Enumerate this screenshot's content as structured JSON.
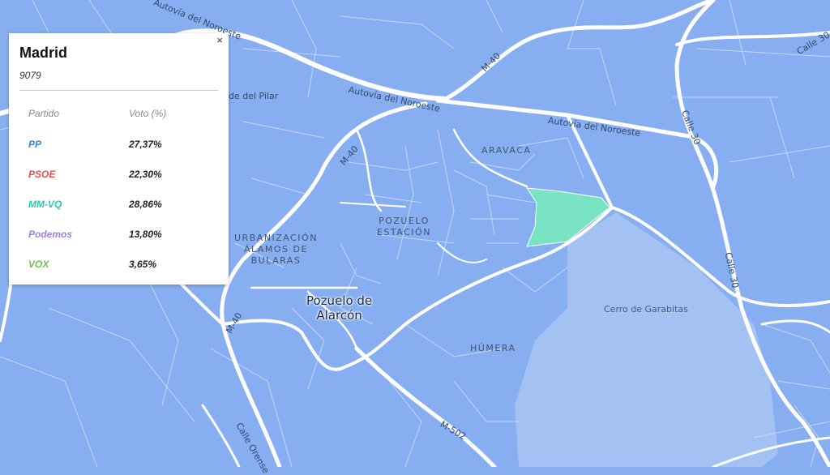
{
  "popup": {
    "title": "Madrid",
    "code": "9079",
    "close": "×",
    "col_party": "Partido",
    "col_vote": "Voto (%)",
    "rows": [
      {
        "party": "PP",
        "vote": "27,37%",
        "color": "#3b82d6"
      },
      {
        "party": "PSOE",
        "vote": "22,30%",
        "color": "#ef4b4b"
      },
      {
        "party": "MM-VQ",
        "vote": "28,86%",
        "color": "#2cc9a8"
      },
      {
        "party": "Podemos",
        "vote": "13,80%",
        "color": "#9b7ee8"
      },
      {
        "party": "VOX",
        "vote": "3,65%",
        "color": "#72bf44"
      }
    ]
  },
  "map": {
    "colors": {
      "base": "#86aef0",
      "light": "#a6c4f4",
      "highlight": "#79e3c4",
      "road": "#ffffff"
    },
    "districts": {
      "aravaca": "ARAVACA",
      "pozuelo_estacion_1": "POZUELO",
      "pozuelo_estacion_2": "ESTACIÓN",
      "urbanizacion_1": "URBANIZACIÓN",
      "urbanizacion_2": "ÁLAMOS DE",
      "urbanizacion_3": "BULARAS",
      "humera": "HÚMERA"
    },
    "towns": {
      "pozuelo_1": "Pozuelo de",
      "pozuelo_2": "Alarcón"
    },
    "hill": "Cerro de Garabitas",
    "roads": {
      "autovia_top": "Autovía del Noroeste",
      "autovia_mid": "Autovía del Noroeste",
      "autovia_right": "Autovía del Noroeste",
      "pilar": "de del Pilar",
      "m40_top": "M-40",
      "m40_left": "M-40",
      "m40_bottom": "M-40",
      "calle30_top": "Calle 30",
      "calle30_mid": "Calle 30",
      "calle30_right": "Calle 30",
      "m502": "M-502",
      "orense": "Calle Orense"
    }
  }
}
